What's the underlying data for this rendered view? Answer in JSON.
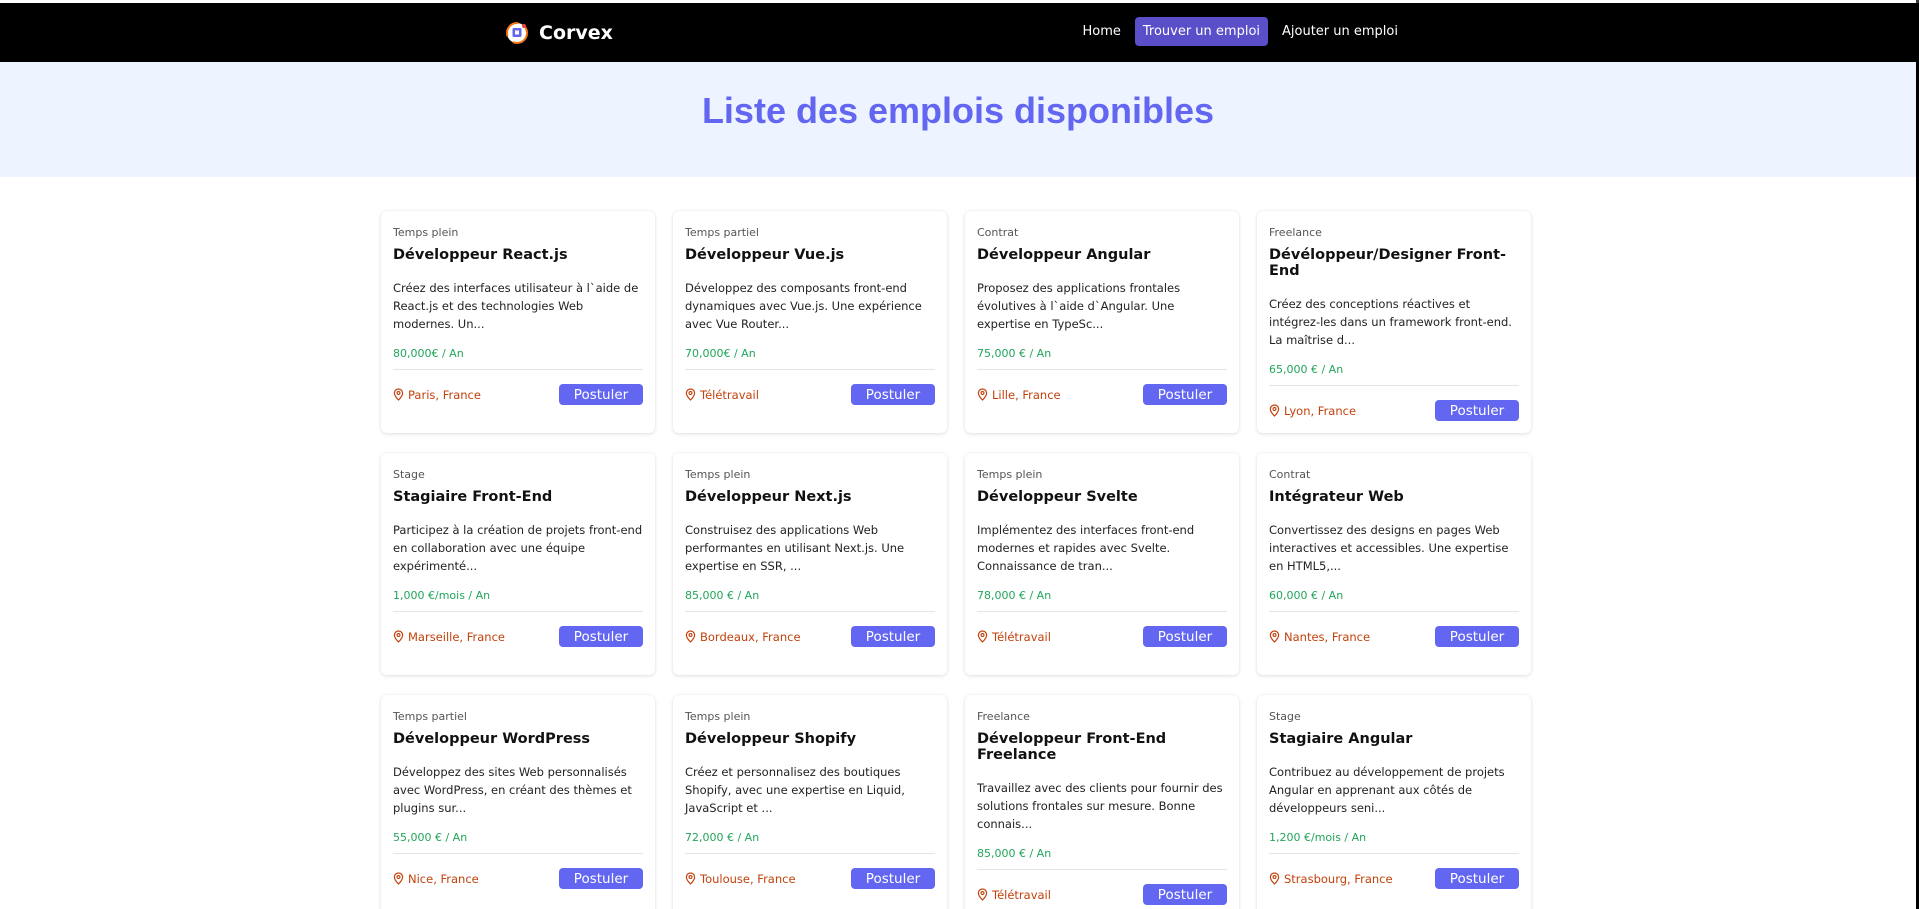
{
  "header": {
    "brand": "Corvex",
    "nav": [
      {
        "label": "Home",
        "active": false
      },
      {
        "label": "Trouver un emploi",
        "active": true
      },
      {
        "label": "Ajouter un emploi",
        "active": false
      }
    ]
  },
  "hero": {
    "title": "Liste des emplois disponibles"
  },
  "colors": {
    "accent": "#6366f1",
    "nav_active": "#5b4fc9",
    "salary": "#22a55a",
    "location": "#c2410c",
    "hero_bg": "#eef4ff"
  },
  "apply_label": "Postuler",
  "jobs": [
    {
      "type": "Temps plein",
      "title": "Développeur React.js",
      "description": "Créez des interfaces utilisateur à l`aide de React.js et des technologies Web modernes. Un...",
      "salary": "80,000€ / An",
      "location": "Paris, France"
    },
    {
      "type": "Temps partiel",
      "title": "Développeur Vue.js",
      "description": "Développez des composants front-end dynamiques avec Vue.js. Une expérience avec Vue Router...",
      "salary": "70,000€ / An",
      "location": "Télétravail"
    },
    {
      "type": "Contrat",
      "title": "Développeur Angular",
      "description": "Proposez des applications frontales évolutives à l`aide d`Angular. Une expertise en TypeSc...",
      "salary": "75,000 € / An",
      "location": "Lille, France"
    },
    {
      "type": "Freelance",
      "title": "Dévéloppeur/Designer Front-End",
      "description": "Créez des conceptions réactives et intégrez-les dans un framework front-end. La maîtrise d...",
      "salary": "65,000 € / An",
      "location": "Lyon, France"
    },
    {
      "type": "Stage",
      "title": "Stagiaire Front-End",
      "description": "Participez à la création de projets front-end en collaboration avec une équipe expérimenté...",
      "salary": "1,000 €/mois / An",
      "location": "Marseille, France"
    },
    {
      "type": "Temps plein",
      "title": "Développeur Next.js",
      "description": "Construisez des applications Web performantes en utilisant Next.js. Une expertise en SSR, ...",
      "salary": "85,000 € / An",
      "location": "Bordeaux, France"
    },
    {
      "type": "Temps plein",
      "title": "Développeur Svelte",
      "description": "Implémentez des interfaces front-end modernes et rapides avec Svelte. Connaissance de tran...",
      "salary": "78,000 € / An",
      "location": "Télétravail"
    },
    {
      "type": "Contrat",
      "title": "Intégrateur Web",
      "description": "Convertissez des designs en pages Web interactives et accessibles. Une expertise en HTML5,...",
      "salary": "60,000 € / An",
      "location": "Nantes, France"
    },
    {
      "type": "Temps partiel",
      "title": "Développeur WordPress",
      "description": "Développez des sites Web personnalisés avec WordPress, en créant des thèmes et plugins sur...",
      "salary": "55,000 € / An",
      "location": "Nice, France"
    },
    {
      "type": "Temps plein",
      "title": "Développeur Shopify",
      "description": "Créez et personnalisez des boutiques Shopify, avec une expertise en Liquid, JavaScript et ...",
      "salary": "72,000 € / An",
      "location": "Toulouse, France"
    },
    {
      "type": "Freelance",
      "title": "Développeur Front-End Freelance",
      "description": "Travaillez avec des clients pour fournir des solutions frontales sur mesure. Bonne connais...",
      "salary": "85,000 € / An",
      "location": "Télétravail"
    },
    {
      "type": "Stage",
      "title": "Stagiaire Angular",
      "description": "Contribuez au développement de projets Angular en apprenant aux côtés de développeurs seni...",
      "salary": "1,200 €/mois / An",
      "location": "Strasbourg, France"
    }
  ]
}
